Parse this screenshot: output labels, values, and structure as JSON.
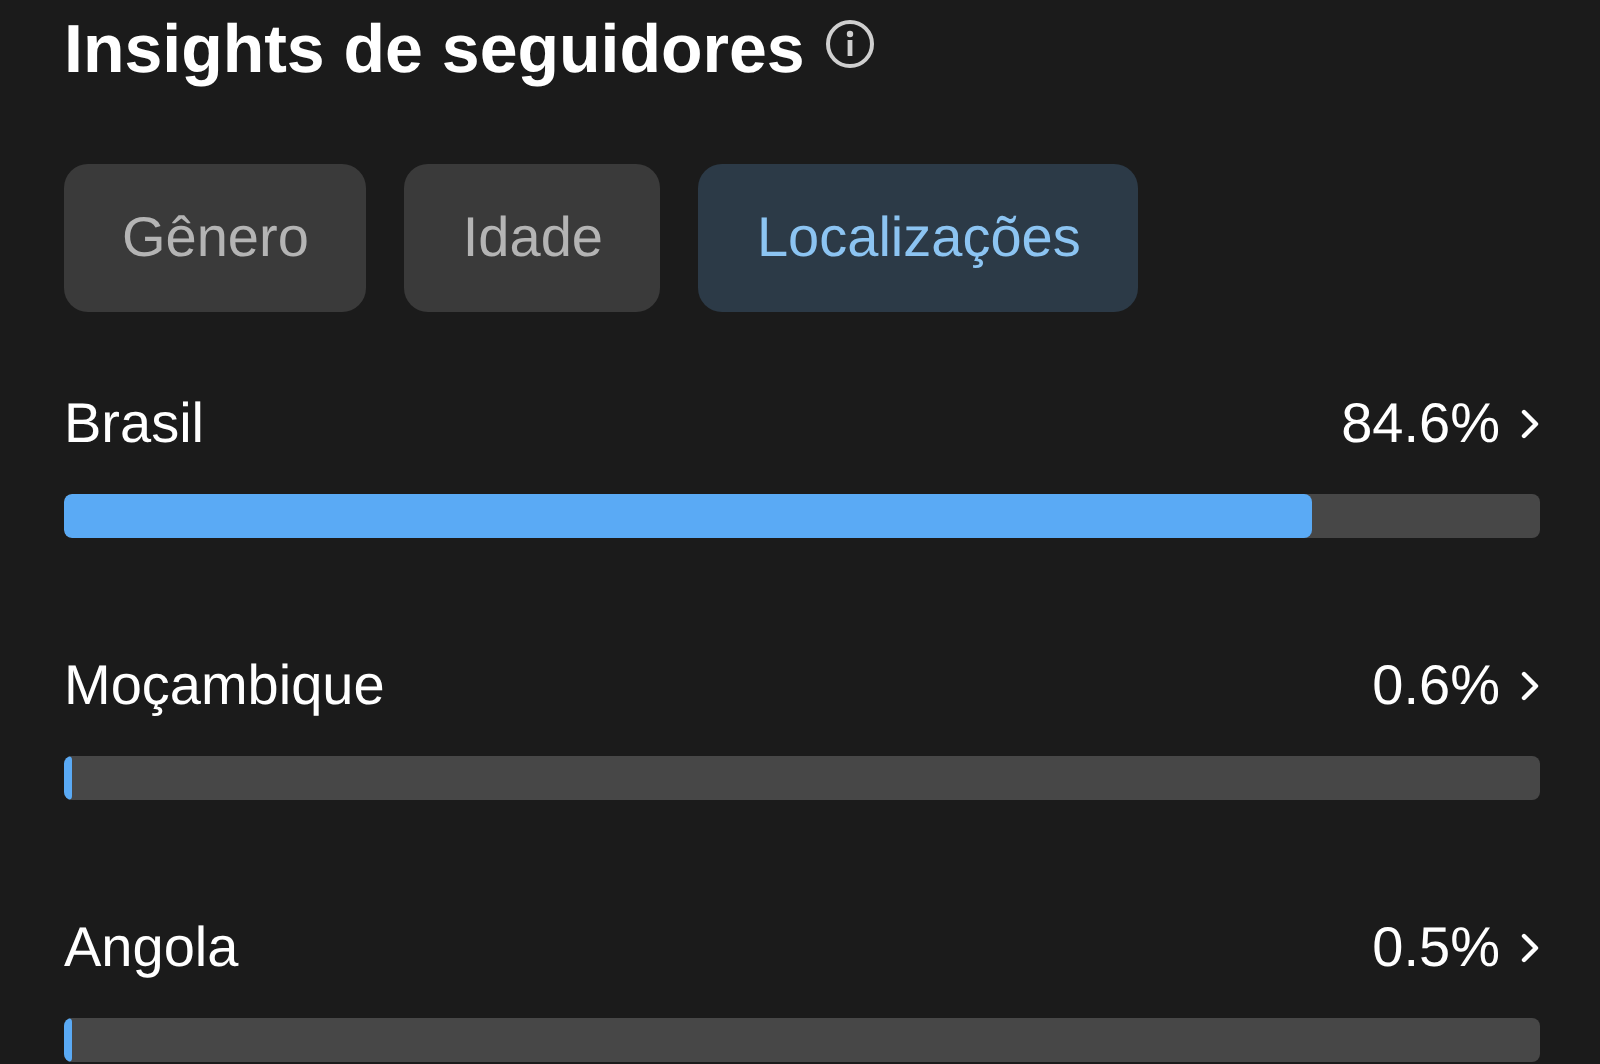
{
  "title": "Insights de seguidores",
  "tabs": [
    {
      "label": "Gênero",
      "selected": false
    },
    {
      "label": "Idade",
      "selected": false
    },
    {
      "label": "Localizações",
      "selected": true
    }
  ],
  "locations": [
    {
      "name": "Brasil",
      "percent": "84.6%",
      "level": 0.846
    },
    {
      "name": "Moçambique",
      "percent": "0.6%",
      "level": 0.006
    },
    {
      "name": "Angola",
      "percent": "0.5%",
      "level": 0.005
    }
  ]
}
